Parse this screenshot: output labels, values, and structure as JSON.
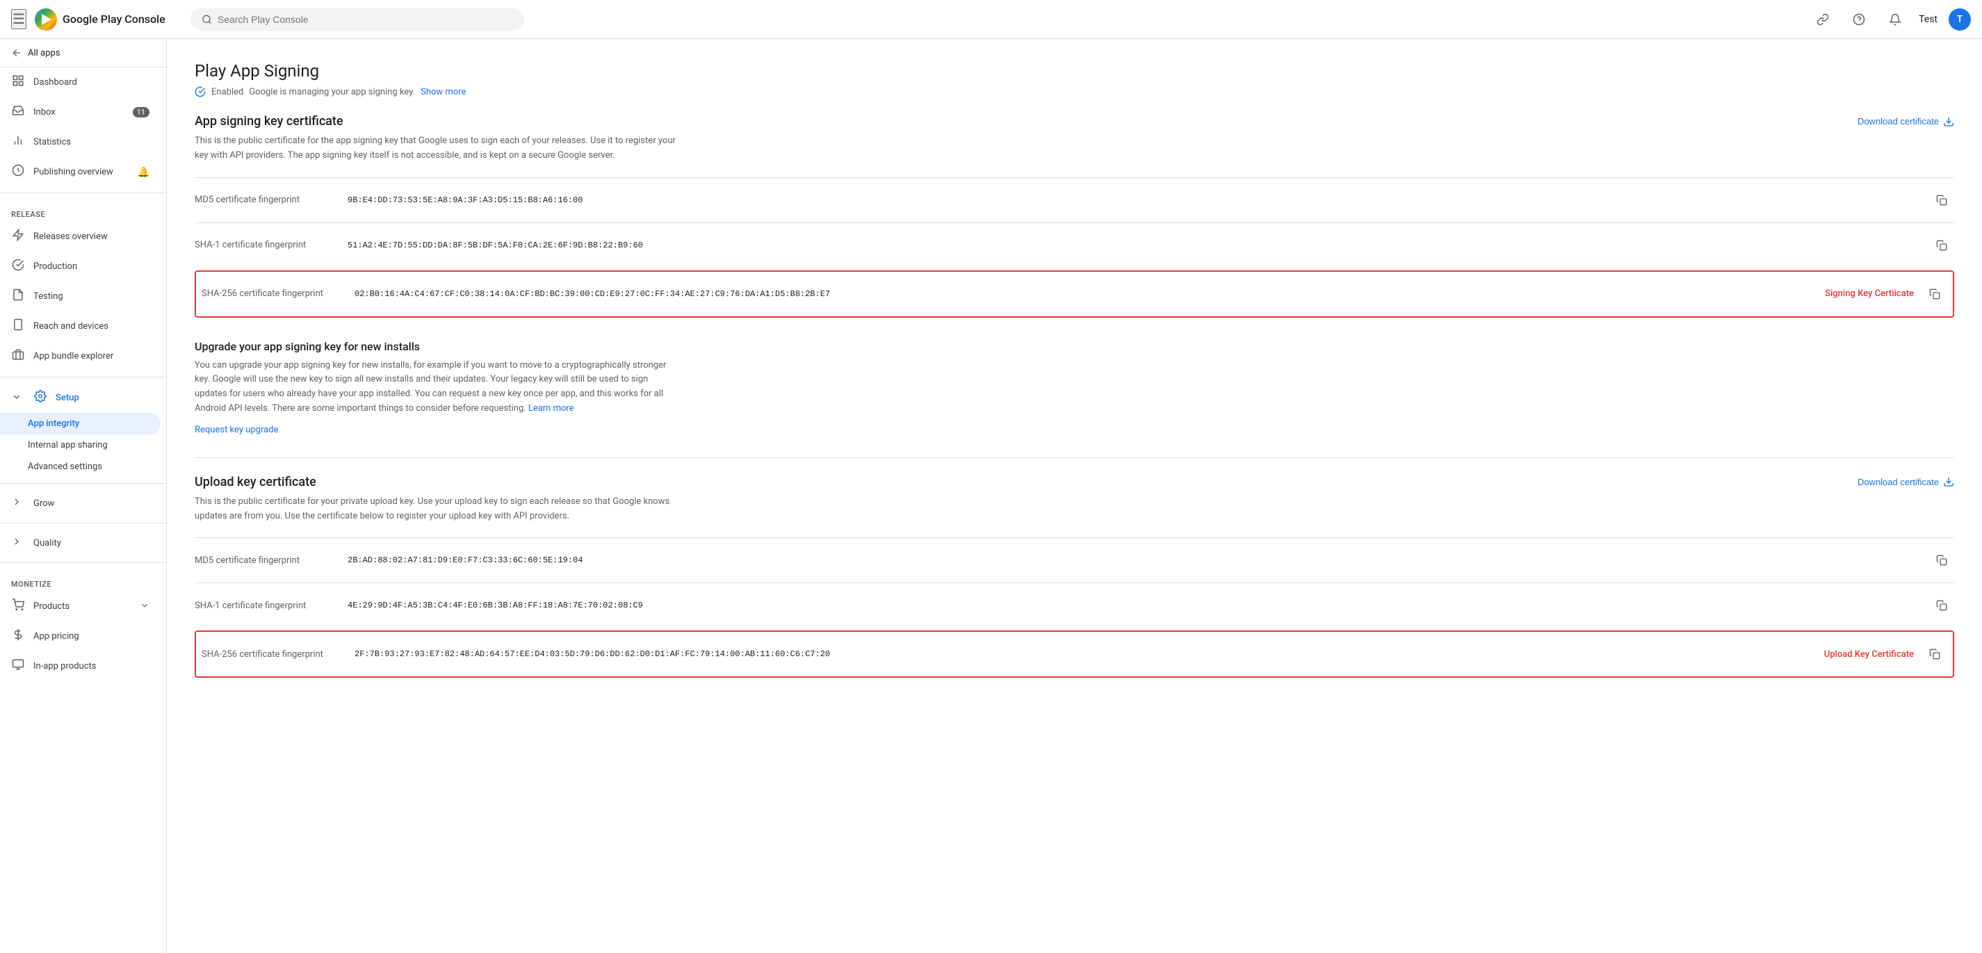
{
  "topbar": {
    "menu_icon": "☰",
    "logo_alt": "Google Play",
    "title": "Google Play Console",
    "search_placeholder": "Search Play Console",
    "help_icon": "?",
    "link_icon": "🔗",
    "notifications_icon": "🔔",
    "test_label": "Test",
    "avatar_letter": "T"
  },
  "sidebar": {
    "all_apps_label": "All apps",
    "nav_items": [
      {
        "id": "dashboard",
        "label": "Dashboard",
        "icon": "⊞",
        "badge": null
      },
      {
        "id": "inbox",
        "label": "Inbox",
        "icon": "✉",
        "badge": "11"
      },
      {
        "id": "statistics",
        "label": "Statistics",
        "icon": "📊",
        "badge": null
      },
      {
        "id": "publishing-overview",
        "label": "Publishing overview",
        "icon": "📋",
        "badge": null
      }
    ],
    "release_section": "Release",
    "release_items": [
      {
        "id": "releases-overview",
        "label": "Releases overview",
        "icon": "🚀"
      },
      {
        "id": "production",
        "label": "Production",
        "icon": "🏭"
      },
      {
        "id": "testing",
        "label": "Testing",
        "icon": "🧪"
      },
      {
        "id": "reach-and-devices",
        "label": "Reach and devices",
        "icon": "📱"
      },
      {
        "id": "app-bundle-explorer",
        "label": "App bundle explorer",
        "icon": "📦"
      }
    ],
    "setup_label": "Setup",
    "setup_items": [
      {
        "id": "app-integrity",
        "label": "App integrity",
        "active": true
      },
      {
        "id": "internal-app-sharing",
        "label": "Internal app sharing"
      },
      {
        "id": "advanced-settings",
        "label": "Advanced settings"
      }
    ],
    "grow_label": "Grow",
    "quality_label": "Quality",
    "monetize_label": "Monetize",
    "products_label": "Products",
    "app_pricing_label": "App pricing",
    "in_app_products_label": "In-app products"
  },
  "main": {
    "page_title": "Play App Signing",
    "status_enabled": "Enabled",
    "status_desc": "Google is managing your app signing key.",
    "show_more": "Show more",
    "signing_section": {
      "title": "App signing key certificate",
      "download_label": "Download certificate",
      "desc": "This is the public certificate for the app signing key that Google uses to sign each of your releases. Use it to register your key with API providers. The app signing key itself is not accessible, and is kept on a secure Google server.",
      "rows": [
        {
          "label": "MD5 certificate fingerprint",
          "value": "9B:E4:DD:73:53:5E:A8:9A:3F:A3:D5:15:B8:A6:16:00",
          "highlighted": false,
          "badge": ""
        },
        {
          "label": "SHA-1 certificate fingerprint",
          "value": "51:A2:4E:7D:55:DD:DA:8F:5B:DF:5A:F0:CA:2E:6F:9D:B8:22:B9:60",
          "highlighted": false,
          "badge": ""
        },
        {
          "label": "SHA-256 certificate fingerprint",
          "value": "02:B0:16:4A:C4:67:CF:C0:38:14:0A:CF:BD:BC:39:00:CD:E9:27:0C:FF:34:AE:27:C9:76:DA:A1:D5:B8:2B:E7",
          "highlighted": true,
          "badge": "Signing Key Certiicate"
        }
      ]
    },
    "upgrade_section": {
      "title": "Upgrade your app signing key for new installs",
      "desc": "You can upgrade your app signing key for new installs, for example if you want to move to a cryptographically stronger key. Google will use the new key to sign all new installs and their updates. Your legacy key will still be used to sign updates for users who already have your app installed. You can request a new key once per app, and this works for all Android API levels. There are some important things to consider before requesting.",
      "learn_more": "Learn more",
      "request_link": "Request key upgrade"
    },
    "upload_section": {
      "title": "Upload key certificate",
      "download_label": "Download certificate",
      "desc": "This is the public certificate for your private upload key. Use your upload key to sign each release so that Google knows updates are from you. Use the certificate below to register your upload key with API providers.",
      "rows": [
        {
          "label": "MD5 certificate fingerprint",
          "value": "2B:AD:88:02:A7:81:D9:E0:F7:C3:33:6C:60:5E:19:04",
          "highlighted": false,
          "badge": ""
        },
        {
          "label": "SHA-1 certificate fingerprint",
          "value": "4E:29:9D:4F:A5:3B:C4:4F:E0:6B:3B:A8:FF:18:A8:7E:70:02:08:C9",
          "highlighted": false,
          "badge": ""
        },
        {
          "label": "SHA-256 certificate fingerprint",
          "value": "2F:7B:93:27:93:E7:82:48:AD:64:57:EE:D4:03:5D:79:D6:DD:62:D0:D1:AF:FC:79:14:00:AB:11:60:C6:C7:20",
          "highlighted": true,
          "badge": "Upload Key Certificate"
        }
      ]
    }
  }
}
